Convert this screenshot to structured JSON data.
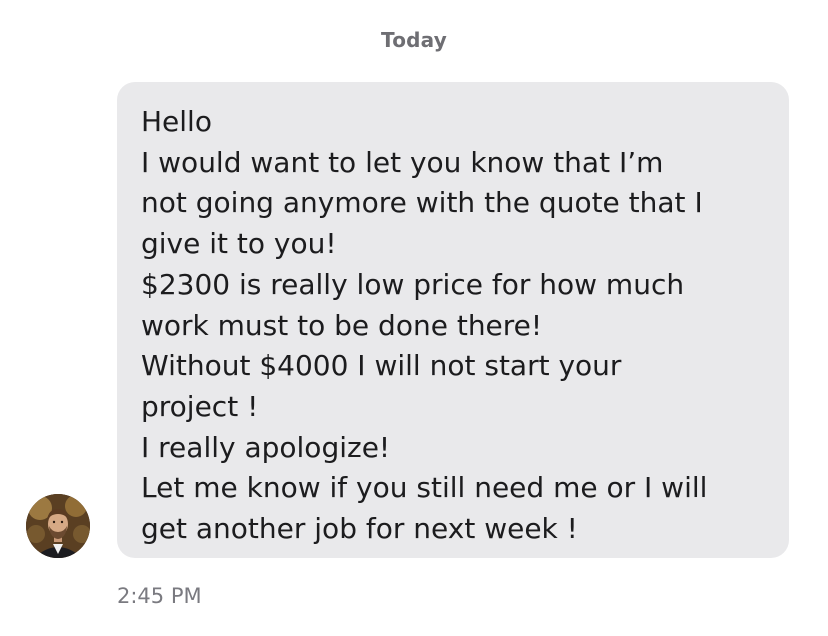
{
  "conversation": {
    "date_separator": "Today"
  },
  "message": {
    "lines": [
      "Hello",
      "I would want to let you know that I’m",
      "not going anymore with the quote that I",
      "give it to you!",
      "$2300 is really low price for how much",
      "work must to be done there!",
      "Without $4000 I will not start your",
      "project !",
      "I really apologize!",
      "Let me know if you still need me or I will",
      "get another job for next week !"
    ],
    "timestamp": "2:45 PM",
    "sender_avatar_icon": "profile-photo",
    "bubble_color": "#e9e9eb"
  }
}
